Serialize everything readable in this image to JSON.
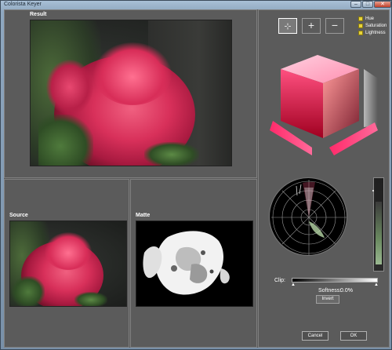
{
  "window": {
    "title": "Colorista Keyer",
    "controls": [
      "–",
      "□",
      "✕"
    ]
  },
  "panels": {
    "result_label": "Result",
    "source_label": "Source",
    "matte_label": "Matte"
  },
  "tools": {
    "pick_icon": "eyedropper-icon",
    "add_icon": "plus-icon",
    "subtract_icon": "minus-icon"
  },
  "channels": [
    {
      "label": "Hue",
      "checked": true
    },
    {
      "label": "Saturation",
      "checked": true
    },
    {
      "label": "Lightness",
      "checked": true
    }
  ],
  "clip": {
    "label": "Clip:"
  },
  "softness": {
    "label": "Softness:",
    "value": "0.0%"
  },
  "invert_label": "Invert",
  "footer": {
    "cancel_label": "Cancel",
    "ok_label": "OK"
  },
  "colors": {
    "accent": "#e8d43a",
    "rose": "#d8305a",
    "panel": "#5b5b5b"
  }
}
